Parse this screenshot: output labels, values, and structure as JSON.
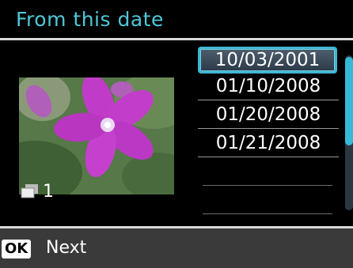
{
  "header": {
    "title": "From this date"
  },
  "dates": {
    "items": [
      "10/03/2001",
      "01/10/2008",
      "01/20/2008",
      "01/21/2008"
    ],
    "selected_index": 0
  },
  "photo": {
    "copies": "1",
    "copies_icon": "copies-icon"
  },
  "footer": {
    "ok_label": "OK",
    "next_label": "Next"
  },
  "colors": {
    "accent": "#3fb6d2",
    "title": "#4ec8d8"
  }
}
